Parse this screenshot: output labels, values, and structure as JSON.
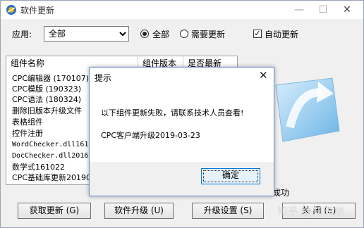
{
  "window": {
    "title": "软件更新"
  },
  "toolbar": {
    "app_label": "应用:",
    "app_selected": "全部",
    "radio_all_label": "全部",
    "radio_needed_label": "需要更新",
    "auto_update_label": "自动更新",
    "auto_update_checked": true,
    "selected_radio": "all"
  },
  "list": {
    "columns": [
      "组件名称",
      "组件版本",
      "是否最新"
    ],
    "rows": [
      "CPC编辑器 (170107)",
      "CPC模版 (190323)",
      "CPC语法 (180324)",
      "删除旧版本升级文件",
      "表格组件",
      "控件注册",
      "WordChecker.dll1610",
      "DocChecker.dll20161",
      "数学式161022",
      "CPC基础库更新201903"
    ]
  },
  "status": {
    "text": "新成功"
  },
  "buttons": {
    "fetch": "获取更新 (G)",
    "upgrade": "软件升级 (U)",
    "settings": "升级设置 (S)",
    "close": "关 闭 (E)"
  },
  "dialog": {
    "title": "提示",
    "message": "以下组件更新失败，请联系技术人员查看!",
    "detail": "CPC客户端升级2019-03-23",
    "ok": "确定"
  },
  "watermark": "知乎 @知天地",
  "colors": {
    "dialog_border": "#6b8fcf",
    "ok_border": "#0078d7",
    "window_bg": "#f0f0f0"
  }
}
